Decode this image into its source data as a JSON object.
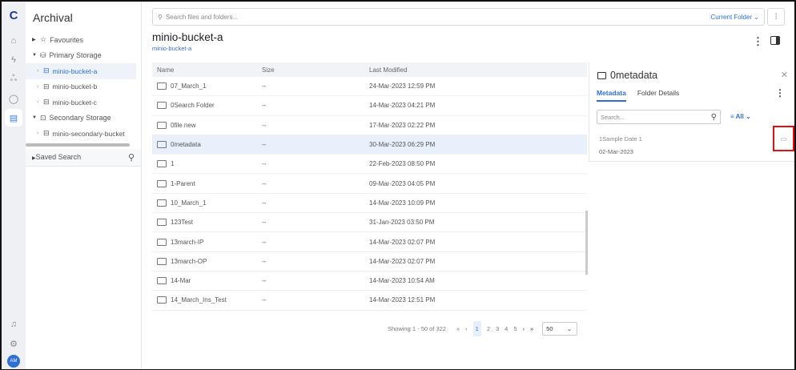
{
  "app": {
    "title": "Archival",
    "avatar": "AM"
  },
  "rail": [
    "logo-icon",
    "home-icon",
    "lightning-icon",
    "network-icon",
    "circle-icon",
    "archive-icon",
    "bell-icon",
    "settings-icon"
  ],
  "sidebar": {
    "favourites": "Favourites",
    "primary": "Primary Storage",
    "buckets": [
      "minio-bucket-a",
      "minio-bucket-b",
      "minio-bucket-c"
    ],
    "secondary": "Secondary Storage",
    "secondary_buckets": [
      "minio-secondary-bucket"
    ],
    "saved_search": "Saved Search"
  },
  "search": {
    "placeholder": "Search files and folders...",
    "scope": "Current Folder"
  },
  "header": {
    "title": "minio-bucket-a",
    "breadcrumb": "minio-bucket-a"
  },
  "table": {
    "columns": [
      "Name",
      "Size",
      "Last Modified"
    ],
    "rows": [
      {
        "name": "07_March_1",
        "size": "--",
        "modified": "24-Mar-2023 12:59 PM"
      },
      {
        "name": "0Search Folder",
        "size": "--",
        "modified": "14-Mar-2023 04:21 PM"
      },
      {
        "name": "0file new",
        "size": "--",
        "modified": "17-Mar-2023 02:22 PM"
      },
      {
        "name": "0metadata",
        "size": "--",
        "modified": "30-Mar-2023 06:29 PM",
        "selected": true
      },
      {
        "name": "1",
        "size": "--",
        "modified": "22-Feb-2023 08:50 PM"
      },
      {
        "name": "1-Parent",
        "size": "--",
        "modified": "09-Mar-2023 04:05 PM",
        "locked": true
      },
      {
        "name": "10_March_1",
        "size": "--",
        "modified": "14-Mar-2023 10:09 PM"
      },
      {
        "name": "123Test",
        "size": "--",
        "modified": "31-Jan-2023 03:50 PM"
      },
      {
        "name": "13march-IP",
        "size": "--",
        "modified": "14-Mar-2023 02:07 PM"
      },
      {
        "name": "13march-OP",
        "size": "--",
        "modified": "14-Mar-2023 02:07 PM"
      },
      {
        "name": "14-Mar",
        "size": "--",
        "modified": "14-Mar-2023 10:54 AM"
      },
      {
        "name": "14_March_Ins_Test",
        "size": "--",
        "modified": "14-Mar-2023 12:51 PM"
      }
    ]
  },
  "pagination": {
    "showing": "Showing 1 - 50 of 322",
    "pages": [
      "1",
      "2",
      "3",
      "4",
      "5"
    ],
    "current": "1",
    "page_size": "50"
  },
  "details": {
    "title": "0metadata",
    "tabs": [
      "Metadata",
      "Folder Details"
    ],
    "search_placeholder": "Search...",
    "filter": "All",
    "field_label": "1Sample Date 1",
    "field_value": "02-Mar-2023"
  }
}
